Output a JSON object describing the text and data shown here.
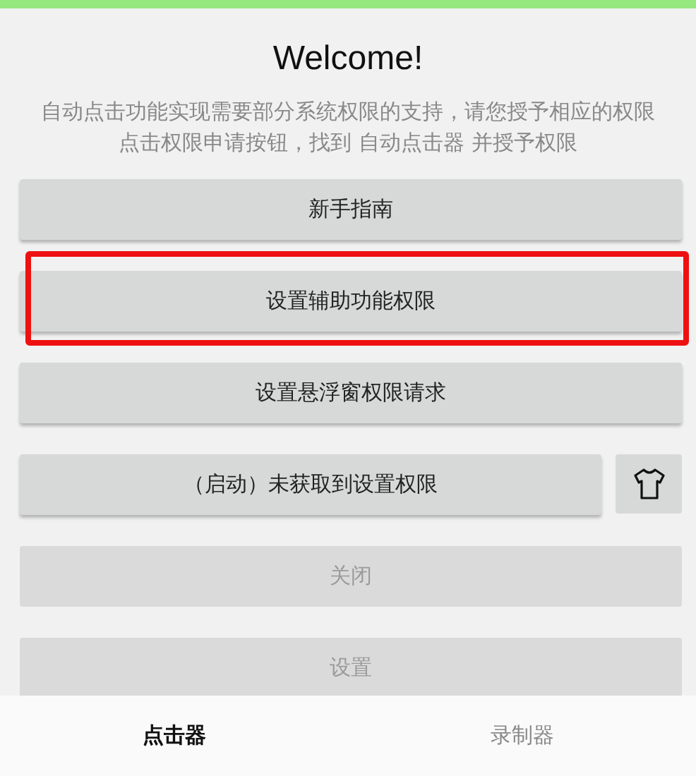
{
  "title": "Welcome!",
  "intro_lines": [
    "自动点击功能实现需要部分系统权限的支持，请您授予相应的权限",
    "点击权限申请按钮，找到 自动点击器 并授予权限"
  ],
  "buttons": [
    {
      "label": "新手指南",
      "disabled": false,
      "highlighted": false,
      "side_button": false
    },
    {
      "label": "设置辅助功能权限",
      "disabled": false,
      "highlighted": true,
      "side_button": false
    },
    {
      "label": "设置悬浮窗权限请求",
      "disabled": false,
      "highlighted": false,
      "side_button": false
    },
    {
      "label": "（启动）未获取到设置权限",
      "disabled": false,
      "highlighted": false,
      "side_button": true
    },
    {
      "label": "关闭",
      "disabled": true,
      "highlighted": false,
      "side_button": false
    },
    {
      "label": "设置",
      "disabled": true,
      "highlighted": false,
      "side_button": false
    }
  ],
  "tabs": [
    {
      "label": "点击器",
      "selected": true
    },
    {
      "label": "录制器",
      "selected": false
    }
  ]
}
